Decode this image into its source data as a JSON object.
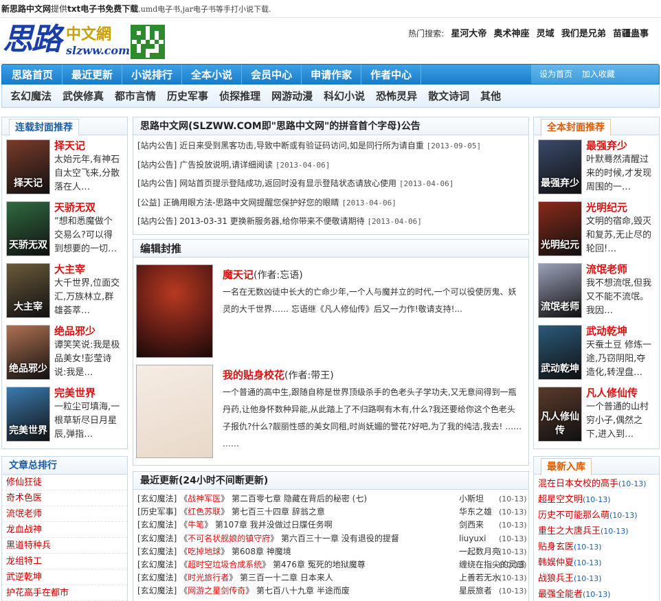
{
  "topbar": {
    "bold": "新思路中文网",
    "t1": "提供",
    "t2": "txt电子书免费下载",
    "t3": ",umd电子书,jar电子书等手打小说下载."
  },
  "logo": {
    "big": "思路",
    "small": "中文網",
    "domain": "slzww.com"
  },
  "hotsearch": {
    "label": "热门搜索:",
    "items": [
      "星河大帝",
      "奥术神座",
      "灵域",
      "我们是兄弟",
      "苗疆蛊事"
    ]
  },
  "nav": {
    "items": [
      "思路首页",
      "最近更新",
      "小说排行",
      "全本小说",
      "会员中心",
      "申请作家",
      "作者中心"
    ],
    "right": [
      "设为首页",
      "加入收藏"
    ]
  },
  "subnav": [
    "玄幻魔法",
    "武侠修真",
    "都市言情",
    "历史军事",
    "侦探推理",
    "网游动漫",
    "科幻小说",
    "恐怖灵异",
    "散文诗词",
    "其他"
  ],
  "left_top": {
    "title": "连载封面推荐",
    "books": [
      {
        "title": "择天记",
        "desc": "太始元年,有神石自太空飞来,分散落在人…",
        "cover_color": "#7a3b2a"
      },
      {
        "title": "天骄无双",
        "desc": "“想和悉魔做个交易么?可以得到想要的一切…",
        "cover_color": "#2f6a3f"
      },
      {
        "title": "大主宰",
        "desc": "大千世界,位面交汇,万族林立,群雄荟萃…",
        "cover_color": "#6a5a3a"
      },
      {
        "title": "绝品邪少",
        "desc": "谭笑笑说:我是极品美女!彭莹诗说:我是…",
        "cover_color": "#b07050"
      },
      {
        "title": "完美世界",
        "desc": "一粒尘可填海,一根草斩尽日月星辰,弹指…",
        "cover_color": "#3a7ab0"
      }
    ]
  },
  "left_rank": {
    "title": "文章总排行",
    "items": [
      "修仙狂徒",
      "奇术色医",
      "流氓老师",
      "龙血战神",
      "黑道特种兵",
      "龙组特工",
      "武逆乾坤",
      "护花高手在都市"
    ]
  },
  "announce": {
    "title": "思路中文网(SLZWW.COM即\"思路中文网\"的拼音首个字母)公告",
    "items": [
      {
        "tag": "[站内公告]",
        "text": "近日来受到黑客功击,导致中断或有验证码访问,如是同行所为请自重",
        "date": "[2013-09-05]"
      },
      {
        "tag": "[站内公告]",
        "text": "广告投放说明,请详细阅读",
        "date": "[2013-04-06]"
      },
      {
        "tag": "[站内公告]",
        "text": "网站首页提示登陆成功,返回时没有显示登陆状态请放心使用",
        "date": "[2013-04-06]"
      },
      {
        "tag": "[公益]",
        "text": "正确用眼方法-思路中文网提醒您保护好您的眼睛",
        "date": "[2013-04-06]"
      },
      {
        "tag": "[站内公告]",
        "text": "2013-03-31 更换新服务器,给你带来不便敬请期待",
        "date": "[2013-04-06]"
      }
    ]
  },
  "editor": {
    "title": "编辑封推",
    "books": [
      {
        "title": "魔天记",
        "author": "(作者:忘语)",
        "desc": "一名在无数凶徒中长大的亡命少年,一个人与魔并立的时代,一个可以役使厉鬼、妖灵的大千世界…… 忘语继《凡人修仙传》后又一力作!敬请支持!...",
        "cover_color": "#5a1a14"
      },
      {
        "title": "我的贴身校花",
        "author": "(作者:带王)",
        "desc": "一个普通的高中生,跟随自称是世界顶级杀手的色老头子学功夫,又无意间得到一瓶丹药,让他身怀数种异能,从此踏上了不归路啊有木有,什么?我还要给你这个色老头子报仇?什么?靓丽性感的美女同租,时尚妩媚的警花?好吧,为了我的纯洁,我去! …… ……",
        "cover_color": "#e8d8c8"
      }
    ]
  },
  "updates": {
    "title": "最近更新(24小时不间断更新)",
    "rows": [
      {
        "cat": "[玄幻魔法]",
        "book": "战神军医",
        "chapter": "第二百零七章 隐藏在背后的秘密 (七)",
        "author": "小斯坦",
        "date": "(10-13)"
      },
      {
        "cat": "[历史军事]",
        "book": "红色苏联",
        "chapter": "第七百三十四章 辞翁之意",
        "author": "华东之雄",
        "date": "(10-13)"
      },
      {
        "cat": "[玄幻魔法]",
        "book": "牛笔",
        "chapter": "第107章 我并没做过日牒任务啊",
        "author": "剑西来",
        "date": "(10-13)"
      },
      {
        "cat": "[玄幻魔法]",
        "book": "不可名状舰娘的镇守府",
        "chapter": "第六百三十一章 没有退役的提督",
        "author": "liuyuxi",
        "date": "(10-13)"
      },
      {
        "cat": "[玄幻魔法]",
        "book": "吃掉地球",
        "chapter": "第608章 神魔境",
        "author": "一起数月亮",
        "date": "(10-13)"
      },
      {
        "cat": "[玄幻魔法]",
        "book": "超时空垃圾合成系统",
        "chapter": "第476章 冤死的地狱魔尊",
        "author": "缠绕在指尖的灵感",
        "date": "(10-13)"
      },
      {
        "cat": "[玄幻魔法]",
        "book": "时光旅行者",
        "chapter": "第三百一十二章 日本来人",
        "author": "上善若无水",
        "date": "(10-13)"
      },
      {
        "cat": "[玄幻魔法]",
        "book": "网游之星剑传奇",
        "chapter": "第七百八十九章 半途而废",
        "author": "星辰旅者",
        "date": "(10-13)"
      }
    ]
  },
  "right_top": {
    "title": "全本封面推荐",
    "books": [
      {
        "title": "最强弃少",
        "desc": "叶默蓦然清醒过来的时候,才发现周围的一…",
        "cover_color": "#3a4a6a"
      },
      {
        "title": "光明纪元",
        "desc": "文明的宿命,毁灭和复苏,无止尽的轮回!…",
        "cover_color": "#8a2a1a"
      },
      {
        "title": "流氓老师",
        "desc": "我不想流氓,但我又不能不流氓。我因…",
        "cover_color": "#9aa0b8"
      },
      {
        "title": "武动乾坤",
        "desc": "天蚕土豆 修炼一途,乃窃阴阳,夺造化,转涅盘…",
        "cover_color": "#2a5a7a"
      },
      {
        "title": "凡人修仙传",
        "desc": "一个普通的山村穷小子,偶然之下,进入到…",
        "cover_color": "#5a3a2a"
      }
    ]
  },
  "right_new": {
    "title": "最新入库",
    "items": [
      {
        "name": "混在日本女校的高手",
        "date": "(10-13)"
      },
      {
        "name": "超星空文明",
        "date": "(10-13)"
      },
      {
        "name": "历史不可能那么萌",
        "date": "(10-13)"
      },
      {
        "name": "重生之大唐兵王",
        "date": "(10-13)"
      },
      {
        "name": "贴身玄医",
        "date": "(10-13)"
      },
      {
        "name": "韩娱仲夏",
        "date": "(10-13)"
      },
      {
        "name": "战狼兵王",
        "date": "(10-13)"
      },
      {
        "name": "最强全能者",
        "date": "(10-13)"
      }
    ]
  }
}
